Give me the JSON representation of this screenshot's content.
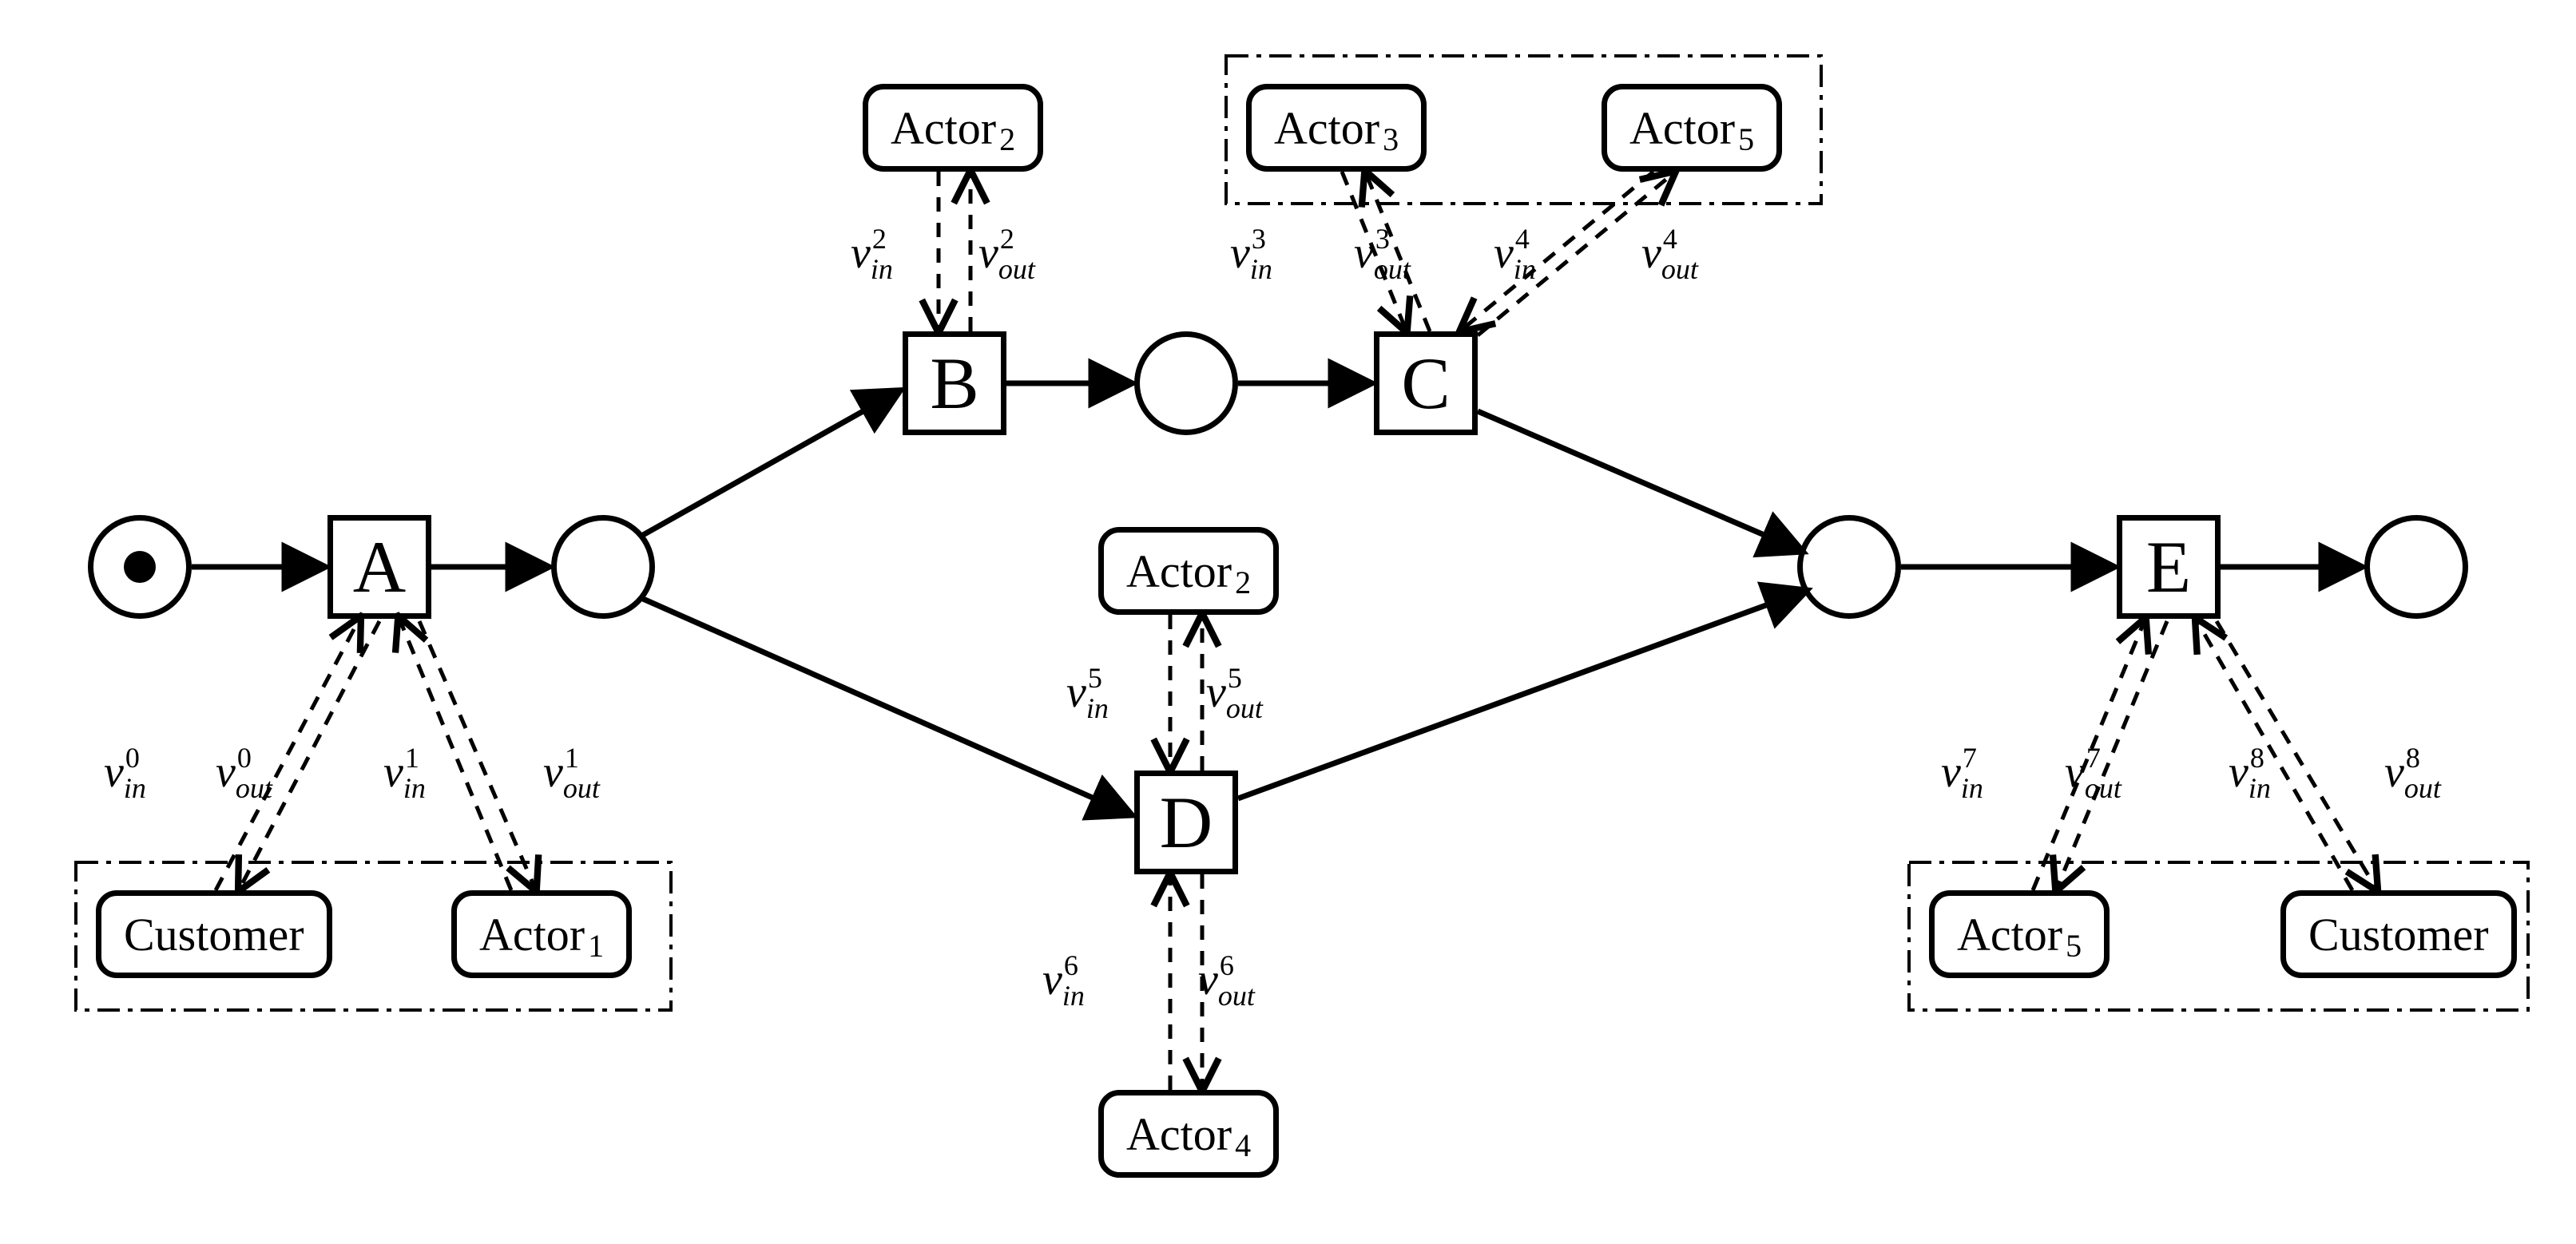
{
  "transitions": {
    "A": "A",
    "B": "B",
    "C": "C",
    "D": "D",
    "E": "E"
  },
  "actors": {
    "customer_A": {
      "name": "Customer"
    },
    "actor1": {
      "name": "Actor",
      "sub": "1"
    },
    "actor2_B": {
      "name": "Actor",
      "sub": "2"
    },
    "actor3": {
      "name": "Actor",
      "sub": "3"
    },
    "actor5_C": {
      "name": "Actor",
      "sub": "5"
    },
    "actor2_D": {
      "name": "Actor",
      "sub": "2"
    },
    "actor4": {
      "name": "Actor",
      "sub": "4"
    },
    "actor5_E": {
      "name": "Actor",
      "sub": "5"
    },
    "customer_E": {
      "name": "Customer"
    }
  },
  "vlabels": {
    "v0in": {
      "v": "v",
      "sub": "in",
      "sup": "0"
    },
    "v0out": {
      "v": "v",
      "sub": "out",
      "sup": "0"
    },
    "v1in": {
      "v": "v",
      "sub": "in",
      "sup": "1"
    },
    "v1out": {
      "v": "v",
      "sub": "out",
      "sup": "1"
    },
    "v2in": {
      "v": "v",
      "sub": "in",
      "sup": "2"
    },
    "v2out": {
      "v": "v",
      "sub": "out",
      "sup": "2"
    },
    "v3in": {
      "v": "v",
      "sub": "in",
      "sup": "3"
    },
    "v3out": {
      "v": "v",
      "sub": "out",
      "sup": "3"
    },
    "v4in": {
      "v": "v",
      "sub": "in",
      "sup": "4"
    },
    "v4out": {
      "v": "v",
      "sub": "out",
      "sup": "4"
    },
    "v5in": {
      "v": "v",
      "sub": "in",
      "sup": "5"
    },
    "v5out": {
      "v": "v",
      "sub": "out",
      "sup": "5"
    },
    "v6in": {
      "v": "v",
      "sub": "in",
      "sup": "6"
    },
    "v6out": {
      "v": "v",
      "sub": "out",
      "sup": "6"
    },
    "v7in": {
      "v": "v",
      "sub": "in",
      "sup": "7"
    },
    "v7out": {
      "v": "v",
      "sub": "out",
      "sup": "7"
    },
    "v8in": {
      "v": "v",
      "sub": "in",
      "sup": "8"
    },
    "v8out": {
      "v": "v",
      "sub": "out",
      "sup": "8"
    }
  }
}
